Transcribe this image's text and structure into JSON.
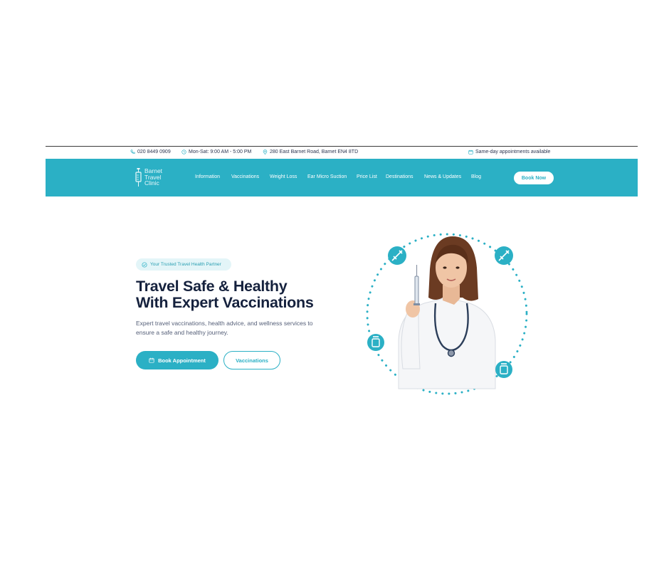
{
  "topbar": {
    "phone": "020 8449 0909",
    "hours": "Mon-Sat: 9:00 AM - 5:00 PM",
    "address": "280 East Barnet Road, Barnet EN4 8TD",
    "same_day": "Same-day appointments available"
  },
  "header": {
    "logo_lines": [
      "Barnet",
      "Travel",
      "Clinic"
    ],
    "nav": [
      "Information",
      "Vaccinations",
      "Weight Loss",
      "Ear Micro Suction",
      "Price List",
      "Destinations",
      "News & Updates",
      "Blog"
    ],
    "book_now": "Book Now"
  },
  "hero": {
    "badge": "Your Trusted Travel Health Partner",
    "title_line1": "Travel Safe & Healthy",
    "title_line2": "With Expert Vaccinations",
    "description": "Expert travel vaccinations, health advice, and wellness services to ensure a safe and healthy journey.",
    "primary_button": "Book Appointment",
    "secondary_button": "Vaccinations"
  },
  "colors": {
    "brand": "#2bb0c5",
    "heading": "#15213d",
    "badge_bg": "#e3f5f8"
  },
  "icons": [
    "phone-icon",
    "clock-icon",
    "location-pin-icon",
    "calendar-icon",
    "shield-check-icon",
    "syringe-icon",
    "vaccine-vial-icon"
  ]
}
